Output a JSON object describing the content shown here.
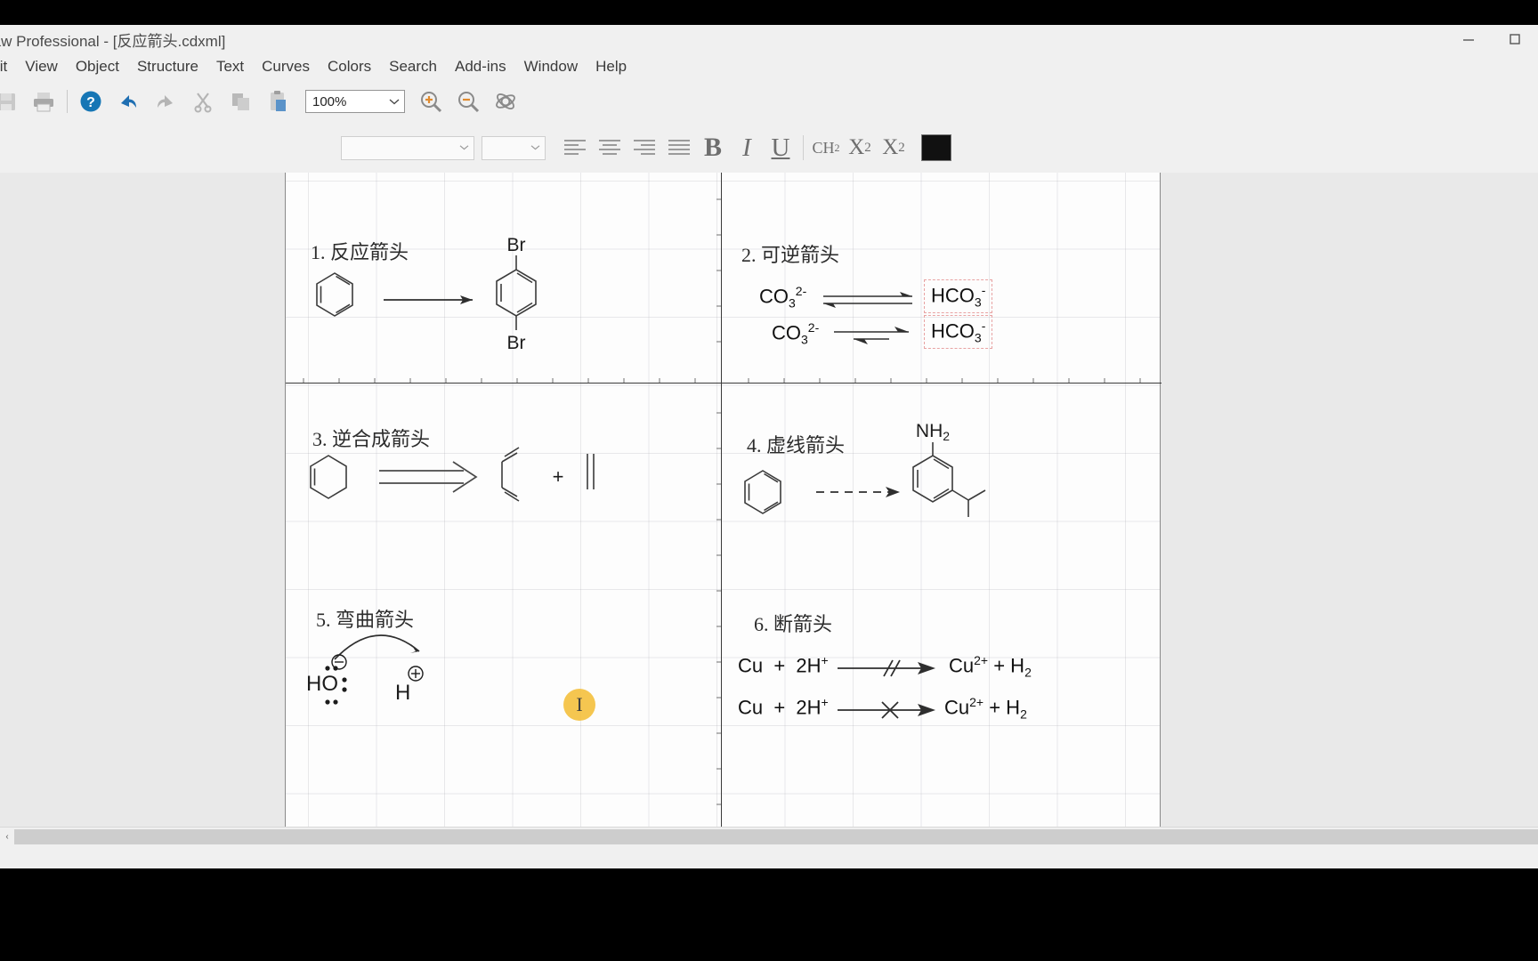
{
  "window": {
    "title": "raw Professional - [反应箭头.cdxml]",
    "minimize_label": "—",
    "maximize_label": "□",
    "icons": {
      "minimize": "minimize-icon",
      "maximize": "maximize-icon"
    }
  },
  "menubar": {
    "items": [
      "lit",
      "View",
      "Object",
      "Structure",
      "Text",
      "Curves",
      "Colors",
      "Search",
      "Add-ins",
      "Window",
      "Help"
    ]
  },
  "toolbar": {
    "icons": [
      {
        "name": "save-icon",
        "title": "Save"
      },
      {
        "name": "print-icon",
        "title": "Print"
      },
      {
        "name": "help-icon",
        "title": "Help"
      },
      {
        "name": "undo-icon",
        "title": "Undo"
      },
      {
        "name": "redo-icon",
        "title": "Redo"
      },
      {
        "name": "cut-icon",
        "title": "Cut"
      },
      {
        "name": "copy-icon",
        "title": "Copy"
      },
      {
        "name": "paste-icon",
        "title": "Paste"
      }
    ],
    "zoom_value": "100%",
    "zoom_in_label": "+",
    "zoom_out_label": "−",
    "rotate3d_title": "3D Rotate"
  },
  "format_toolbar": {
    "font_value": "",
    "font_placeholder": "",
    "size_value": "",
    "size_placeholder": "",
    "align_left": "align-left-icon",
    "align_center": "align-center-icon",
    "align_right": "align-right-icon",
    "align_justify": "align-justify-icon",
    "bold_label": "B",
    "italic_label": "I",
    "underline_label": "U",
    "formula_label": "CH2",
    "subscript_label": "X2",
    "superscript_label": "X2sup",
    "color_hex": "#111111"
  },
  "document": {
    "panels": [
      {
        "id": "panel-1",
        "number": "1.",
        "title": "反应箭头",
        "arrow_type": "solid-reaction-arrow",
        "reactant": "benzene",
        "product": "1,4-dibromobenzene",
        "labels": [
          "Br",
          "Br"
        ]
      },
      {
        "id": "panel-2",
        "number": "2.",
        "title": "可逆箭头",
        "arrow_type": "equilibrium-arrow",
        "rows": [
          {
            "left": "CO3",
            "left_charge": "2-",
            "right": "HCO3",
            "right_charge": "-",
            "arrow": "equilibrium-equal"
          },
          {
            "left": "CO3",
            "left_charge": "2-",
            "right": "HCO3",
            "right_charge": "-",
            "arrow": "equilibrium-unequal"
          }
        ]
      },
      {
        "id": "panel-3",
        "number": "3.",
        "title": "逆合成箭头",
        "arrow_type": "retrosynthetic-arrow",
        "reactant": "cyclohexene",
        "plus_label": "+",
        "products": [
          "1,3-butadiene",
          "ethylene"
        ]
      },
      {
        "id": "panel-4",
        "number": "4.",
        "title": "虚线箭头",
        "arrow_type": "dashed-arrow",
        "reactant": "benzene",
        "product": "3-isopropylaniline",
        "labels": [
          "NH2"
        ]
      },
      {
        "id": "panel-5",
        "number": "5.",
        "title": "弯曲箭头",
        "arrow_type": "curved-arrow",
        "species": [
          {
            "formula": "HO",
            "charge": "⊖"
          },
          {
            "formula": "H",
            "charge": "⊕"
          }
        ]
      },
      {
        "id": "panel-6",
        "number": "6.",
        "title": "断箭头",
        "arrow_type": "no-go-arrow",
        "rows": [
          {
            "left": "Cu  +  2H",
            "left_sup": "+",
            "break_style": "double-slash",
            "right": "Cu",
            "right_sup": "2+",
            "right_tail": " + H",
            "right_sub": "2"
          },
          {
            "left": "Cu  +  2H",
            "left_sup": "+",
            "break_style": "cross",
            "right": "Cu",
            "right_sup": "2+",
            "right_tail": " + H",
            "right_sub": "2"
          }
        ]
      }
    ]
  },
  "cursor": {
    "type": "i-beam-cursor",
    "glyph": "I"
  },
  "scrollbar": {
    "left_arrow": "‹"
  }
}
